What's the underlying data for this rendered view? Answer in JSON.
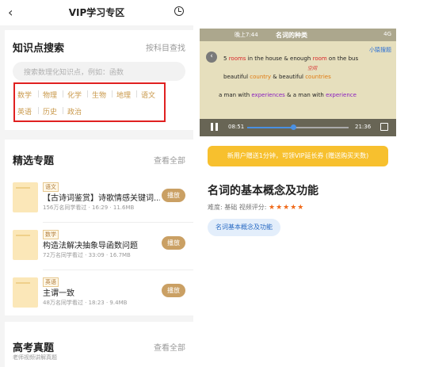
{
  "header": {
    "title": "VIP学习专区",
    "back_icon": "chevron-left-icon",
    "history_icon": "clock-icon"
  },
  "knowledge_search": {
    "title": "知识点搜索",
    "link": "按科目查找",
    "placeholder": "搜索数理化知识点，例如：函数",
    "subjects_row1": [
      "数学",
      "物理",
      "化学",
      "生物",
      "地理",
      "语文"
    ],
    "subjects_row2": [
      "英语",
      "历史",
      "政治"
    ]
  },
  "featured": {
    "title": "精选专题",
    "link": "查看全部",
    "items": [
      {
        "tag": "语文",
        "title": "【古诗词鉴赏】诗歌情感关键词...",
        "meta": "156万名同学看过 · 16:29 · 11.6MB",
        "button": "播放"
      },
      {
        "tag": "数学",
        "title": "构造法解决抽象导函数问题",
        "meta": "72万名同学看过 · 33:09 · 16.7MB",
        "button": "播放"
      },
      {
        "tag": "英语",
        "title": "主谓一致",
        "meta": "48万名同学看过 · 18:23 · 9.4MB",
        "button": "播放"
      }
    ]
  },
  "exam": {
    "title": "高考真题",
    "link": "查看全部",
    "subtitle": "老师视频讲解真题"
  },
  "video": {
    "top_time": "晚上7:44",
    "caption": "名词的种类",
    "status": "4G",
    "brand": "小猿搜题",
    "line1": {
      "a": "5 ",
      "b": "rooms",
      "c": " in the house & enough ",
      "d": "room",
      "e": " on the bus"
    },
    "line2": {
      "a": "beautiful ",
      "b": "country",
      "c": " & beautiful ",
      "d": "countries"
    },
    "line3": {
      "a": "a man with ",
      "b": "experiences",
      "c": " & a man with ",
      "d": "experience"
    },
    "hand_note": "空间",
    "current": "08:51",
    "duration": "21:36",
    "progress": 0.45
  },
  "promo": "新用户赠送1分钟，可领VIP延长券 (赠送购买天数)",
  "detail": {
    "title": "名词的基本概念及功能",
    "rating_label": "难度: 基础   视频评分: ",
    "stars": "★★★★★",
    "tag": "名词基本概念及功能"
  }
}
